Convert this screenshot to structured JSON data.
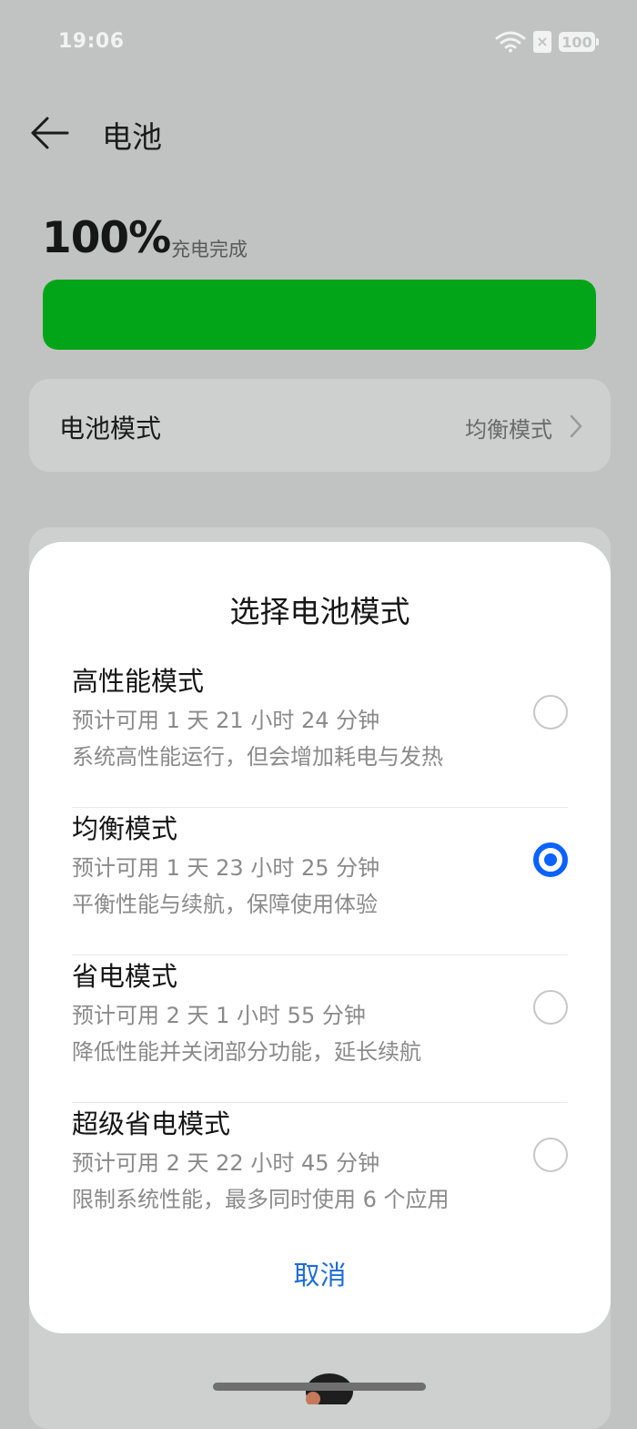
{
  "status_bar": {
    "time": "19:06",
    "sim_label": "×",
    "battery_label": "100",
    "icons": [
      "wifi-icon",
      "sim-icon",
      "battery-icon"
    ]
  },
  "header": {
    "title": "电池",
    "back_icon": "arrow-left-icon"
  },
  "battery": {
    "percent": "100%",
    "status": "充电完成",
    "level_fraction": 1.0,
    "bar_color": "#02a517"
  },
  "mode_row": {
    "label": "电池模式",
    "value": "均衡模式"
  },
  "dialog": {
    "title": "选择电池模式",
    "options": [
      {
        "name": "高性能模式",
        "time": "预计可用 1 天 21 小时 24 分钟",
        "desc": "系统高性能运行，但会增加耗电与发热",
        "checked": false
      },
      {
        "name": "均衡模式",
        "time": "预计可用 1 天 23 小时 25 分钟",
        "desc": "平衡性能与续航，保障使用体验",
        "checked": true
      },
      {
        "name": "省电模式",
        "time": "预计可用 2 天 1 小时 55 分钟",
        "desc": "降低性能并关闭部分功能，延长续航",
        "checked": false
      },
      {
        "name": "超级省电模式",
        "time": "预计可用 2 天 22 小时 45 分钟",
        "desc": "限制系统性能，最多同时使用 6 个应用",
        "checked": false
      }
    ],
    "cancel_label": "取消"
  },
  "colors": {
    "accent": "#0a62ff",
    "cancel_text": "#1d6dd8",
    "background_dim": "#c0c3c2"
  }
}
